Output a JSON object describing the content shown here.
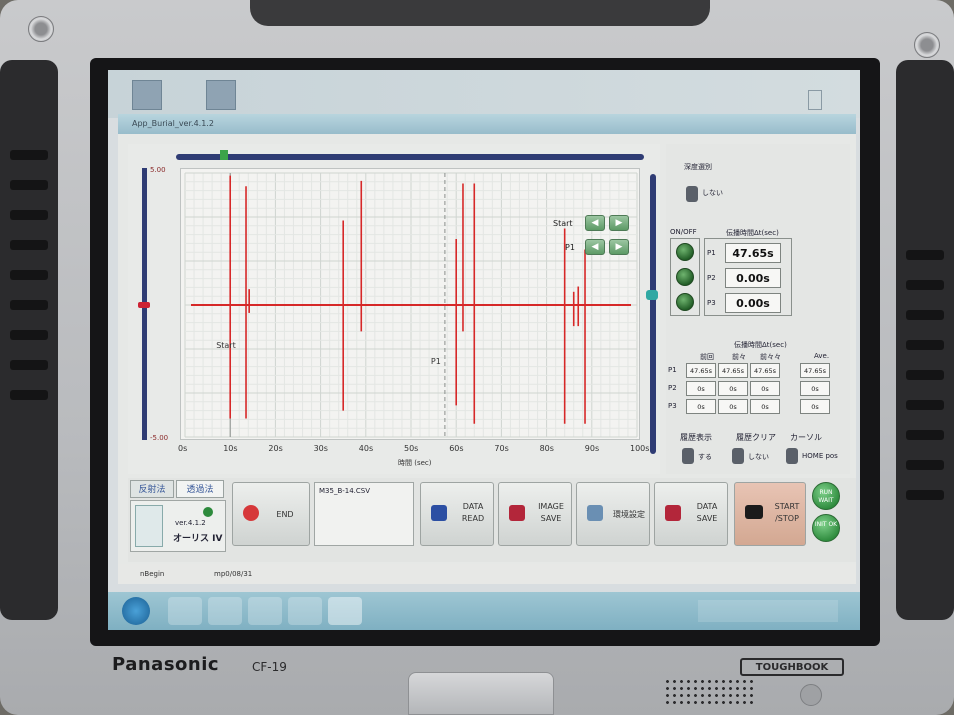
{
  "device": {
    "brand": "Panasonic",
    "model": "CF-19",
    "series": "TOUGHBOOK"
  },
  "window": {
    "title": "App_Burial_ver.4.1.2"
  },
  "chart_data": {
    "type": "line",
    "xlabel": "時間 (sec)",
    "ylabel": "",
    "xlim": [
      0,
      100
    ],
    "ylim": [
      -5.0,
      5.0
    ],
    "x_ticks": [
      "0s",
      "10s",
      "20s",
      "30s",
      "40s",
      "50s",
      "60s",
      "70s",
      "80s",
      "90s",
      "100s"
    ],
    "y_ticks": [
      "5.00",
      "-5.00"
    ],
    "series": [
      {
        "color": "#d62828",
        "baseline": 0.0,
        "spikes": [
          {
            "x": 10.0,
            "min": -4.3,
            "max": 4.9
          },
          {
            "x": 13.5,
            "min": -4.3,
            "max": 4.5
          },
          {
            "x": 14.2,
            "min": -0.3,
            "max": 0.6
          },
          {
            "x": 35.0,
            "min": -4.0,
            "max": 3.2
          },
          {
            "x": 39.0,
            "min": -1.0,
            "max": 4.7
          },
          {
            "x": 60.0,
            "min": -3.8,
            "max": 2.5
          },
          {
            "x": 61.5,
            "min": -1.0,
            "max": 4.6
          },
          {
            "x": 64.0,
            "min": -4.5,
            "max": 4.6
          },
          {
            "x": 84.0,
            "min": -4.5,
            "max": 2.9
          },
          {
            "x": 86.0,
            "min": -0.8,
            "max": 0.5
          },
          {
            "x": 87.0,
            "min": -0.8,
            "max": 0.7
          },
          {
            "x": 88.5,
            "min": -4.5,
            "max": 2.1
          }
        ]
      }
    ],
    "markers": [
      {
        "label": "Start",
        "x": 10.0
      },
      {
        "label": "P1",
        "x": 57.5
      }
    ],
    "grid": true
  },
  "plot_controls": {
    "start_label": "Start",
    "p1_label": "P1"
  },
  "right_panel": {
    "mode_title": "深度選別",
    "mode_switch_label": "しない",
    "onoff_label": "ON/OFF",
    "propagation_header": "伝播時間Δt(sec)",
    "rows": [
      {
        "label": "P1",
        "value": "47.65s"
      },
      {
        "label": "P2",
        "value": "0.00s"
      },
      {
        "label": "P3",
        "value": "0.00s"
      }
    ],
    "history_header": "伝播時間Δt(sec)",
    "history_columns": [
      "前回",
      "前々",
      "前々々",
      "Ave."
    ],
    "history_rows": [
      {
        "label": "P1",
        "cells": [
          "47.65s",
          "47.65s",
          "47.65s"
        ],
        "ave": "47.65s"
      },
      {
        "label": "P2",
        "cells": [
          "0s",
          "0s",
          "0s"
        ],
        "ave": "0s"
      },
      {
        "label": "P3",
        "cells": [
          "0s",
          "0s",
          "0s"
        ],
        "ave": "0s"
      }
    ],
    "history_display_label": "履歴表示",
    "history_clear_label": "履歴クリア",
    "cursor_label": "カーソル",
    "display_switch_label": "する",
    "clear_switch_label": "しない",
    "cursor_switch_label": "HOME pos"
  },
  "bottom_panel": {
    "tab_reflection": "反射法",
    "tab_transmission": "透過法",
    "version": "ver.4.1.2",
    "product": "オーリス IV",
    "end_label": "END",
    "file_name": "M35_B-14.CSV",
    "data_read_label": "DATA READ",
    "image_save_label": "IMAGE SAVE",
    "settings_label": "環境設定",
    "data_save_label": "DATA SAVE",
    "start_stop_label": "START /STOP",
    "run_label": "RUN WAIT",
    "init_label": "INIT OK"
  },
  "status_bar": {
    "left_text": "nBegin",
    "mid_text": "mp0/08/31"
  },
  "colors": {
    "signal": "#d62828",
    "slider": "#2f3c74",
    "lamp": "#2d7a33",
    "taskbar": "#8ab8c8"
  }
}
